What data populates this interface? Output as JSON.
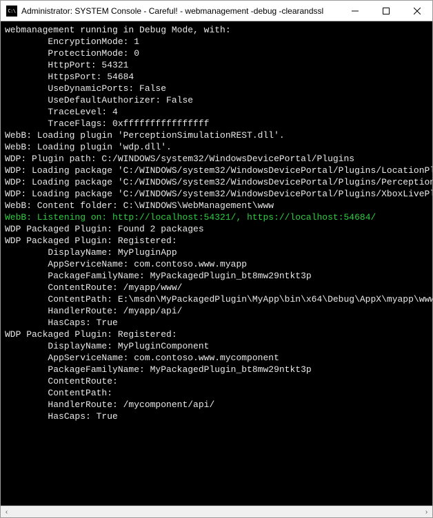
{
  "window": {
    "icon_label": "C:\\",
    "title": "Administrator:  SYSTEM Console - Careful! - webmanagement  -debug -clearandssl",
    "minimize_tip": "Minimize",
    "maximize_tip": "Maximize",
    "close_tip": "Close"
  },
  "lines": [
    {
      "text": "webmanagement running in Debug Mode, with:"
    },
    {
      "text": "        EncryptionMode: 1"
    },
    {
      "text": "        ProtectionMode: 0"
    },
    {
      "text": "        HttpPort: 54321"
    },
    {
      "text": "        HttpsPort: 54684"
    },
    {
      "text": "        UseDynamicPorts: False"
    },
    {
      "text": "        UseDefaultAuthorizer: False"
    },
    {
      "text": "        TraceLevel: 4"
    },
    {
      "text": "        TraceFlags: 0xffffffffffffffff"
    },
    {
      "text": "WebB: Loading plugin 'PerceptionSimulationREST.dll'."
    },
    {
      "text": "WebB: Loading plugin 'wdp.dll'."
    },
    {
      "text": "WDP: Plugin path: C:/WINDOWS/system32/WindowsDevicePortal/Plugins"
    },
    {
      "text": "WDP: Loading package 'C:/WINDOWS/system32/WindowsDevicePortal/Plugins/LocationPlugin"
    },
    {
      "text": "WDP: Loading package 'C:/WINDOWS/system32/WindowsDevicePortal/Plugins/Perception/pac"
    },
    {
      "text": "WDP: Loading package 'C:/WINDOWS/system32/WindowsDevicePortal/Plugins/XboxLivePlugin"
    },
    {
      "text": "WebB: Content folder: C:\\WINDOWS\\WebManagement\\www"
    },
    {
      "segments": [
        {
          "text": "WebB: Listening on: ",
          "cls": "green"
        },
        {
          "text": "http://localhost:54321/",
          "cls": "url"
        },
        {
          "text": ", ",
          "cls": "green"
        },
        {
          "text": "https://localhost:54684/",
          "cls": "url"
        }
      ]
    },
    {
      "text": ""
    },
    {
      "text": "WDP Packaged Plugin: Found 2 packages"
    },
    {
      "text": "WDP Packaged Plugin: Registered:"
    },
    {
      "text": "        DisplayName: MyPluginApp"
    },
    {
      "text": "        AppServiceName: com.contoso.www.myapp"
    },
    {
      "text": "        PackageFamilyName: MyPackagedPlugin_bt8mw29ntkt3p"
    },
    {
      "text": "        ContentRoute: /myapp/www/"
    },
    {
      "text": "        ContentPath: E:\\msdn\\MyPackagedPlugin\\MyApp\\bin\\x64\\Debug\\AppX\\myapp\\www\\"
    },
    {
      "text": "        HandlerRoute: /myapp/api/"
    },
    {
      "text": "        HasCaps: True"
    },
    {
      "text": "WDP Packaged Plugin: Registered:"
    },
    {
      "text": "        DisplayName: MyPluginComponent"
    },
    {
      "text": "        AppServiceName: com.contoso.www.mycomponent"
    },
    {
      "text": "        PackageFamilyName: MyPackagedPlugin_bt8mw29ntkt3p"
    },
    {
      "text": "        ContentRoute:"
    },
    {
      "text": "        ContentPath:"
    },
    {
      "text": "        HandlerRoute: /mycomponent/api/"
    },
    {
      "text": "        HasCaps: True"
    }
  ],
  "scroll": {
    "left_arrow": "‹",
    "right_arrow": "›"
  }
}
